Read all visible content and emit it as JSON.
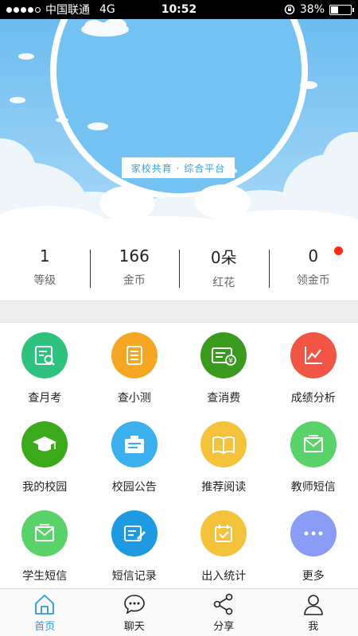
{
  "status_bar": {
    "carrier": "中国联通",
    "network": "4G",
    "time": "10:52",
    "battery": "38%",
    "battery_level": 0.38
  },
  "hero": {
    "banner_text": "家校共育 · 综合平台"
  },
  "stats": [
    {
      "value": "1",
      "label": "等级"
    },
    {
      "value": "166",
      "label": "金币"
    },
    {
      "value": "0朵",
      "label": "红花"
    },
    {
      "value": "0",
      "label": "领金币"
    }
  ],
  "grid": [
    {
      "label": "查月考",
      "icon": "exam-search-icon",
      "color": "#2ec27e"
    },
    {
      "label": "查小测",
      "icon": "quiz-list-icon",
      "color": "#f5a623"
    },
    {
      "label": "查消费",
      "icon": "consumption-card-icon",
      "color": "#3a9a1e"
    },
    {
      "label": "成绩分析",
      "icon": "grade-chart-icon",
      "color": "#f05545"
    },
    {
      "label": "我的校园",
      "icon": "graduation-cap-icon",
      "color": "#3aa91a"
    },
    {
      "label": "校园公告",
      "icon": "notice-board-icon",
      "color": "#3bb0ee"
    },
    {
      "label": "推荐阅读",
      "icon": "open-book-icon",
      "color": "#f5c33b"
    },
    {
      "label": "教师短信",
      "icon": "teacher-message-icon",
      "color": "#5ad26a"
    },
    {
      "label": "学生短信",
      "icon": "student-message-icon",
      "color": "#5ad26a"
    },
    {
      "label": "短信记录",
      "icon": "message-log-icon",
      "color": "#1e9ae0"
    },
    {
      "label": "出入统计",
      "icon": "calendar-check-icon",
      "color": "#f5c33b"
    },
    {
      "label": "更多",
      "icon": "more-dots-icon",
      "color": "#8a9cf5"
    }
  ],
  "tabs": [
    {
      "label": "首页",
      "icon": "home-icon",
      "active": true
    },
    {
      "label": "聊天",
      "icon": "chat-bubble-icon",
      "active": false
    },
    {
      "label": "分享",
      "icon": "share-icon",
      "active": false
    },
    {
      "label": "我",
      "icon": "person-icon",
      "active": false
    }
  ],
  "colors": {
    "accent": "#2e97e0",
    "sky": "#7ec6f2",
    "red_dot": "#ff2a1a"
  }
}
